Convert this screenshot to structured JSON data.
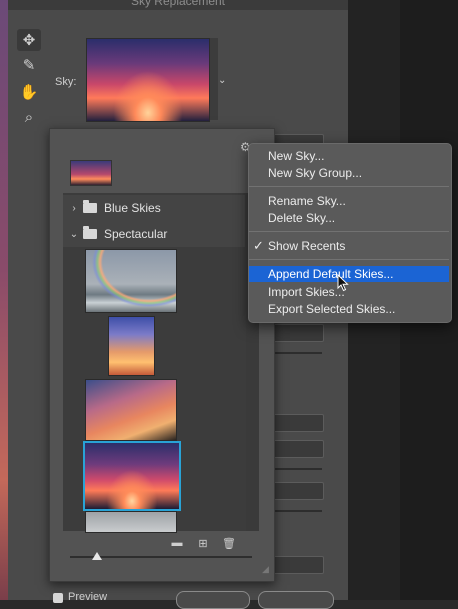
{
  "dialog": {
    "title": "Sky Replacement",
    "sky_label": "Sky:",
    "preview_label": "Preview"
  },
  "tools": [
    {
      "name": "move-tool",
      "glyph": "✥"
    },
    {
      "name": "brush-tool",
      "glyph": "✎"
    },
    {
      "name": "hand-tool",
      "glyph": "✋"
    },
    {
      "name": "zoom-tool",
      "glyph": "⌕"
    }
  ],
  "sky_panel": {
    "groups": [
      {
        "label": "Blue Skies",
        "expanded": false
      },
      {
        "label": "Spectacular",
        "expanded": true
      }
    ],
    "selected_thumbnail_index": 3,
    "icons": [
      "folder-icon",
      "add-icon",
      "trash-icon",
      "gear-icon"
    ]
  },
  "context_menu": {
    "items": [
      "New Sky...",
      "New Sky Group...",
      "Rename Sky...",
      "Delete Sky...",
      "Show Recents",
      "Append Default Skies...",
      "Import Skies...",
      "Export Selected Skies..."
    ],
    "checked_item": "Show Recents",
    "highlighted_item": "Append Default Skies...",
    "check_glyph": "✓"
  },
  "colors": {
    "accent": "#1b64d4",
    "selection_border": "#29a3d6",
    "dialog_bg": "#4a4a4a",
    "menu_bg": "#5a5a5a"
  }
}
